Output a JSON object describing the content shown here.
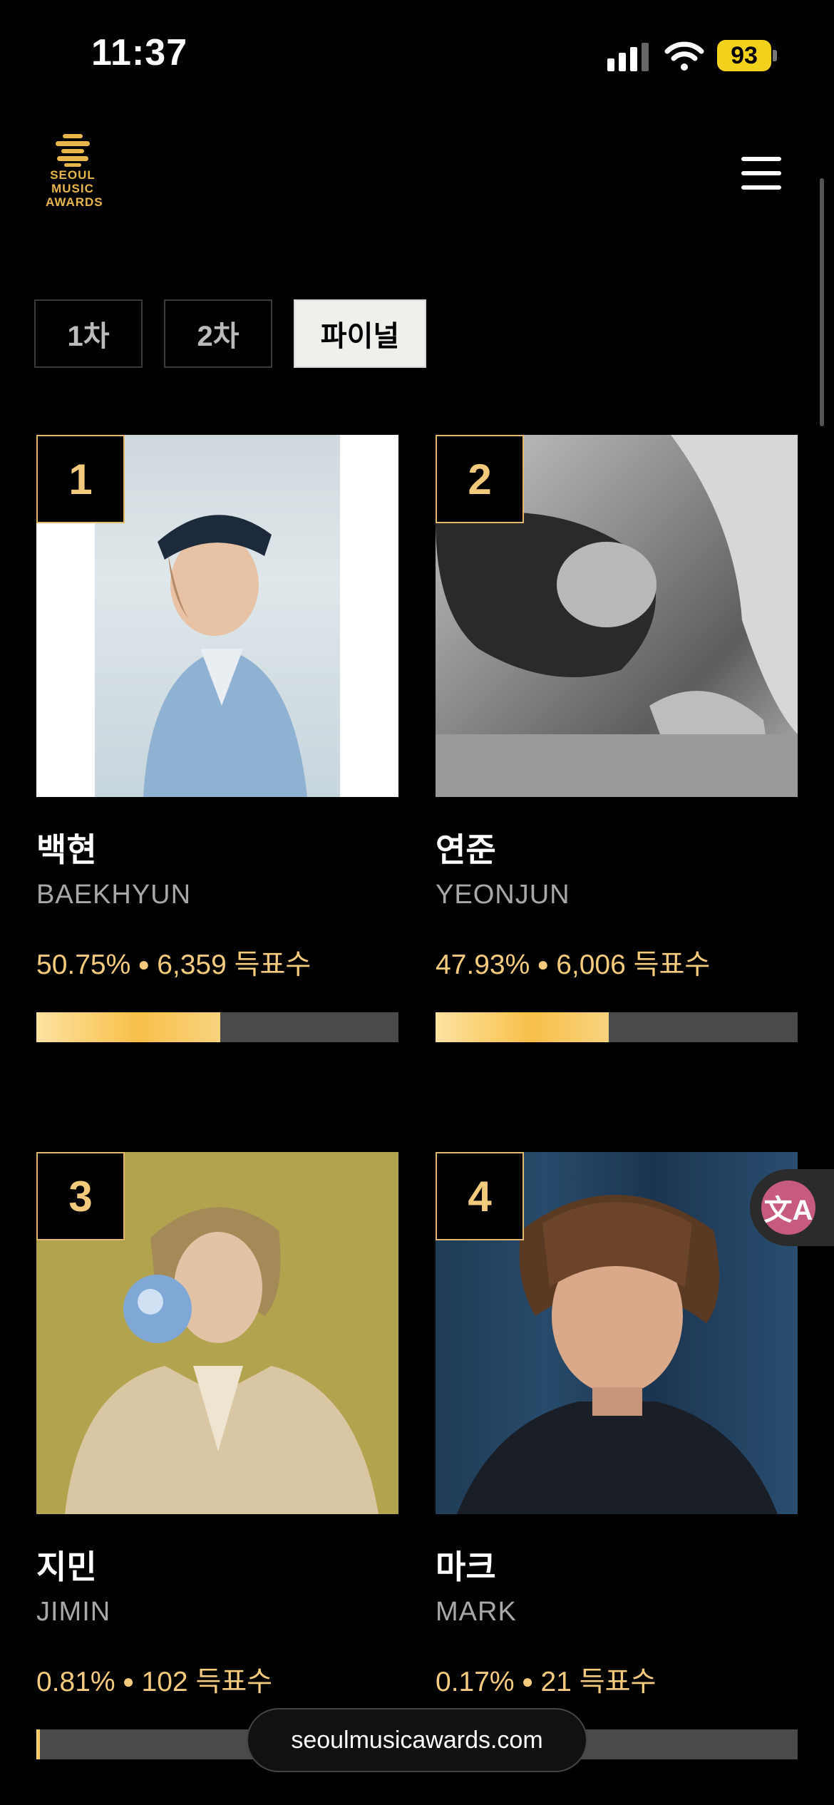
{
  "status_bar": {
    "time": "11:37",
    "battery": "93"
  },
  "header": {
    "logo_lines": [
      "SEOUL",
      "MUSIC",
      "AWARDS"
    ],
    "menu_icon": "hamburger-menu-icon"
  },
  "tabs": [
    {
      "label": "1차",
      "active": false
    },
    {
      "label": "2차",
      "active": false
    },
    {
      "label": "파이널",
      "active": true
    }
  ],
  "candidates": [
    {
      "rank": "1",
      "name_ko": "백현",
      "name_en": "BAEKHYUN",
      "percent": "50.75%",
      "votes": "6,359",
      "votes_label": "득표수",
      "share": 0.5075
    },
    {
      "rank": "2",
      "name_ko": "연준",
      "name_en": "YEONJUN",
      "percent": "47.93%",
      "votes": "6,006",
      "votes_label": "득표수",
      "share": 0.4793
    },
    {
      "rank": "3",
      "name_ko": "지민",
      "name_en": "JIMIN",
      "percent": "0.81%",
      "votes": "102",
      "votes_label": "득표수",
      "share": 0.0081
    },
    {
      "rank": "4",
      "name_ko": "마크",
      "name_en": "MARK",
      "percent": "0.17%",
      "votes": "21",
      "votes_label": "득표수",
      "share": 0.0017
    }
  ],
  "colors": {
    "accent_gold": "#f5cc7d",
    "bar_track": "#4a4a4a"
  },
  "url_bar": {
    "domain": "seoulmusicawards.com"
  }
}
